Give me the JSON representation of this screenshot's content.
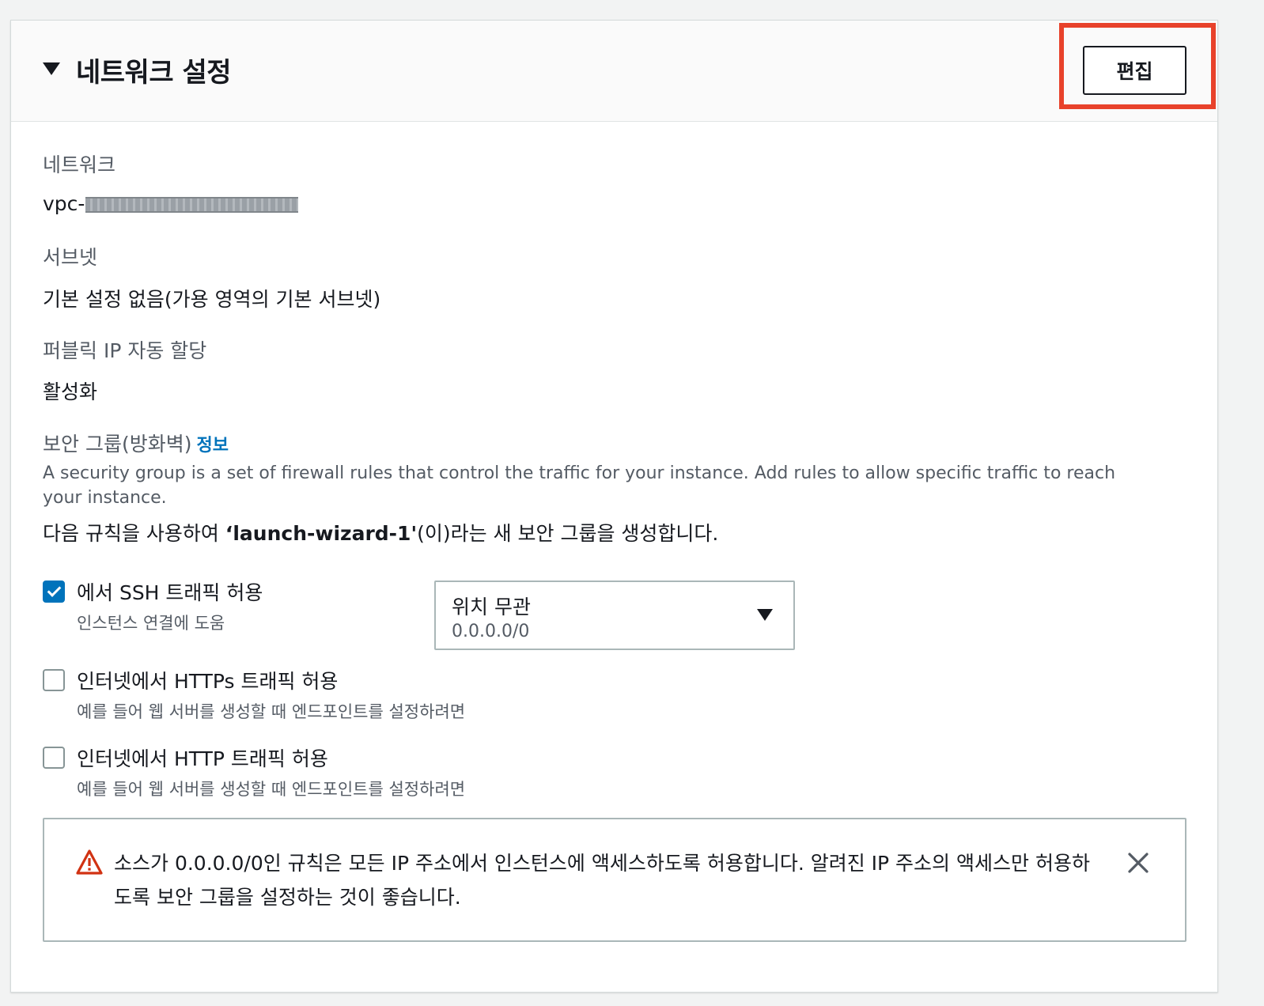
{
  "section": {
    "title": "네트워크 설정",
    "edit_label": "편집"
  },
  "network": {
    "label": "네트워크",
    "value_prefix": "vpc-"
  },
  "subnet": {
    "label": "서브넷",
    "value": "기본 설정 없음(가용 영역의 기본 서브넷)"
  },
  "public_ip": {
    "label": "퍼블릭 IP 자동 할당",
    "value": "활성화"
  },
  "security_group": {
    "label": "보안 그룹(방화벽)",
    "info_link": "정보",
    "description": "A security group is a set of firewall rules that control the traffic for your instance. Add rules to allow specific traffic to reach your instance.",
    "rule_prefix": "다음 규칙을 사용하여 ",
    "group_name": "‘launch-wizard-1'",
    "rule_suffix": "(이)라는 새 보안 그룹을 생성합니다."
  },
  "rules": [
    {
      "label": "에서 SSH 트래픽 허용",
      "sub": "인스턴스 연결에 도움",
      "checked": true
    },
    {
      "label": "인터넷에서 HTTPs 트래픽 허용",
      "sub": "예를 들어 웹 서버를 생성할 때 엔드포인트를 설정하려면",
      "checked": false
    },
    {
      "label": "인터넷에서 HTTP 트래픽 허용",
      "sub": "예를 들어 웹 서버를 생성할 때 엔드포인트를 설정하려면",
      "checked": false
    }
  ],
  "source_select": {
    "selected": "위치 무관",
    "cidr": "0.0.0.0/0"
  },
  "alert": {
    "text": "소스가 0.0.0.0/0인 규칙은 모든 IP 주소에서 인스턴스에 액세스하도록 허용합니다. 알려진 IP 주소의 액세스만 허용하도록 보안 그룹을 설정하는 것이 좋습니다."
  },
  "colors": {
    "link": "#0073bb",
    "checkbox_checked": "#0073bb",
    "highlight": "#e8422b",
    "warning": "#d13212"
  }
}
